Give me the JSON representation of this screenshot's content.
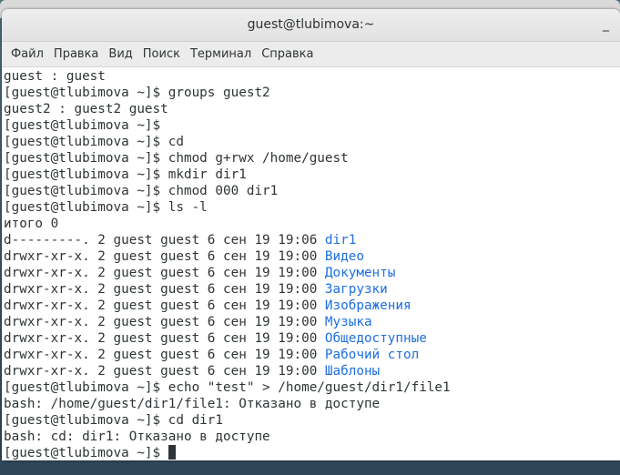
{
  "window": {
    "title": "guest@tlubimova:~",
    "minimize_label": "_"
  },
  "menu": [
    "Файл",
    "Правка",
    "Вид",
    "Поиск",
    "Терминал",
    "Справка"
  ],
  "colors": {
    "dir": "#1f6fe0",
    "text": "#2e3436"
  },
  "terminal": {
    "lines": [
      {
        "text": "guest : guest"
      },
      {
        "text": "[guest@tlubimova ~]$ groups guest2"
      },
      {
        "text": "guest2 : guest2 guest"
      },
      {
        "text": "[guest@tlubimova ~]$"
      },
      {
        "text": "[guest@tlubimova ~]$ cd"
      },
      {
        "text": "[guest@tlubimova ~]$ chmod g+rwx /home/guest"
      },
      {
        "text": "[guest@tlubimova ~]$ mkdir dir1"
      },
      {
        "text": "[guest@tlubimova ~]$ chmod 000 dir1"
      },
      {
        "text": "[guest@tlubimova ~]$ ls -l"
      },
      {
        "text": "итого 0"
      },
      {
        "text": "d---------. 2 guest guest 6 сен 19 19:06 ",
        "name": "dir1"
      },
      {
        "text": "drwxr-xr-x. 2 guest guest 6 сен 19 19:00 ",
        "name": "Видео"
      },
      {
        "text": "drwxr-xr-x. 2 guest guest 6 сен 19 19:00 ",
        "name": "Документы"
      },
      {
        "text": "drwxr-xr-x. 2 guest guest 6 сен 19 19:00 ",
        "name": "Загрузки"
      },
      {
        "text": "drwxr-xr-x. 2 guest guest 6 сен 19 19:00 ",
        "name": "Изображения"
      },
      {
        "text": "drwxr-xr-x. 2 guest guest 6 сен 19 19:00 ",
        "name": "Музыка"
      },
      {
        "text": "drwxr-xr-x. 2 guest guest 6 сен 19 19:00 ",
        "name": "Общедоступные"
      },
      {
        "text": "drwxr-xr-x. 2 guest guest 6 сен 19 19:00 ",
        "name": "Рабочий стол"
      },
      {
        "text": "drwxr-xr-x. 2 guest guest 6 сен 19 19:00 ",
        "name": "Шаблоны"
      },
      {
        "text": "[guest@tlubimova ~]$ echo \"test\" > /home/guest/dir1/file1"
      },
      {
        "text": "bash: /home/guest/dir1/file1: Отказано в доступе"
      },
      {
        "text": "[guest@tlubimova ~]$ cd dir1"
      },
      {
        "text": "bash: cd: dir1: Отказано в доступе"
      },
      {
        "text": "[guest@tlubimova ~]$ ",
        "cursor": true
      }
    ]
  }
}
